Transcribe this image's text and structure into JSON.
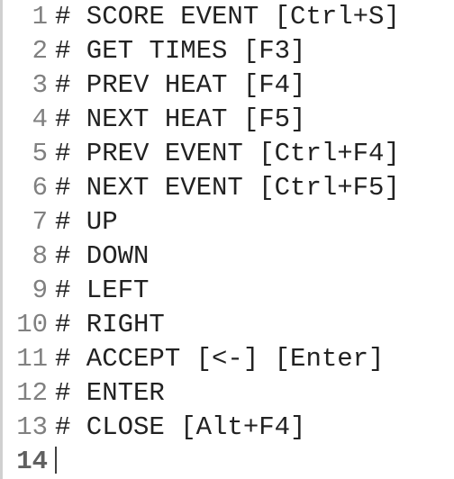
{
  "lines": [
    {
      "num": "1",
      "text": "# SCORE EVENT [Ctrl+S]"
    },
    {
      "num": "2",
      "text": "# GET TIMES [F3]"
    },
    {
      "num": "3",
      "text": "# PREV HEAT [F4]"
    },
    {
      "num": "4",
      "text": "# NEXT HEAT [F5]"
    },
    {
      "num": "5",
      "text": "# PREV EVENT [Ctrl+F4]"
    },
    {
      "num": "6",
      "text": "# NEXT EVENT [Ctrl+F5]"
    },
    {
      "num": "7",
      "text": "# UP"
    },
    {
      "num": "8",
      "text": "# DOWN"
    },
    {
      "num": "9",
      "text": "# LEFT"
    },
    {
      "num": "10",
      "text": "# RIGHT"
    },
    {
      "num": "11",
      "text": "# ACCEPT [<-] [Enter]"
    },
    {
      "num": "12",
      "text": "# ENTER"
    },
    {
      "num": "13",
      "text": "# CLOSE [Alt+F4]"
    },
    {
      "num": "14",
      "text": ""
    }
  ],
  "current_line_index": 13
}
